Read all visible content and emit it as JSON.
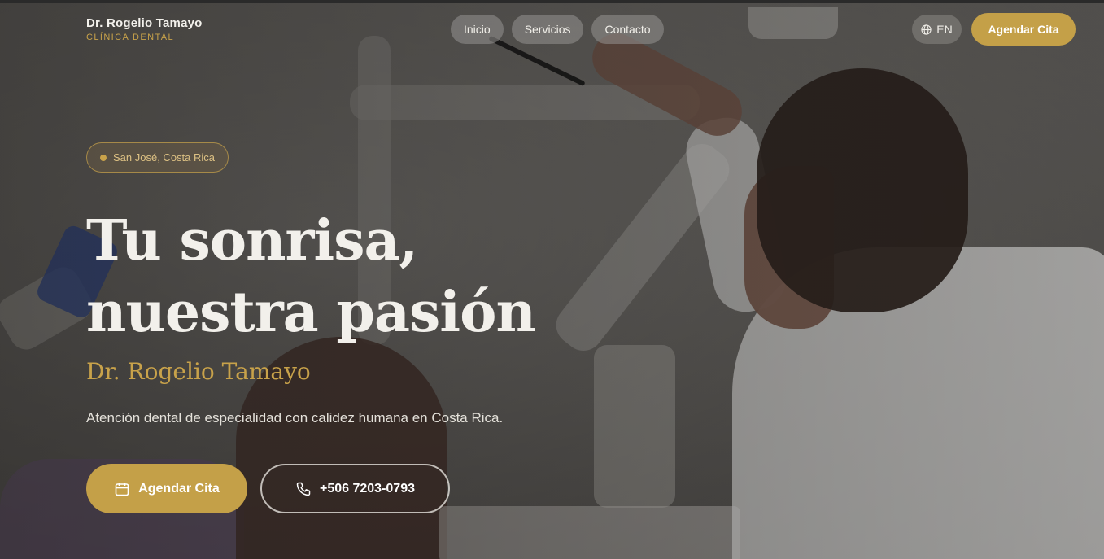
{
  "header": {
    "brand_name": "Dr. Rogelio Tamayo",
    "brand_sub": "CLÍNICA DENTAL",
    "nav": [
      {
        "label": "Inicio"
      },
      {
        "label": "Servicios"
      },
      {
        "label": "Contacto"
      }
    ],
    "lang_label": "EN",
    "lang_icon": "globe-icon",
    "cta_label": "Agendar Cita"
  },
  "hero": {
    "badge": "San José, Costa Rica",
    "headline_line1": "Tu sonrisa,",
    "headline_line2": "nuestra pasión",
    "doctor": "Dr. Rogelio Tamayo",
    "lead": "Atención dental de especialidad con calidez humana en Costa Rica.",
    "primary_button": "Agendar Cita",
    "primary_icon": "calendar-icon",
    "phone_button": "+506 7203-0793",
    "phone_icon": "phone-icon"
  },
  "colors": {
    "accent": "#c4a048",
    "text": "#f2f0eb"
  }
}
